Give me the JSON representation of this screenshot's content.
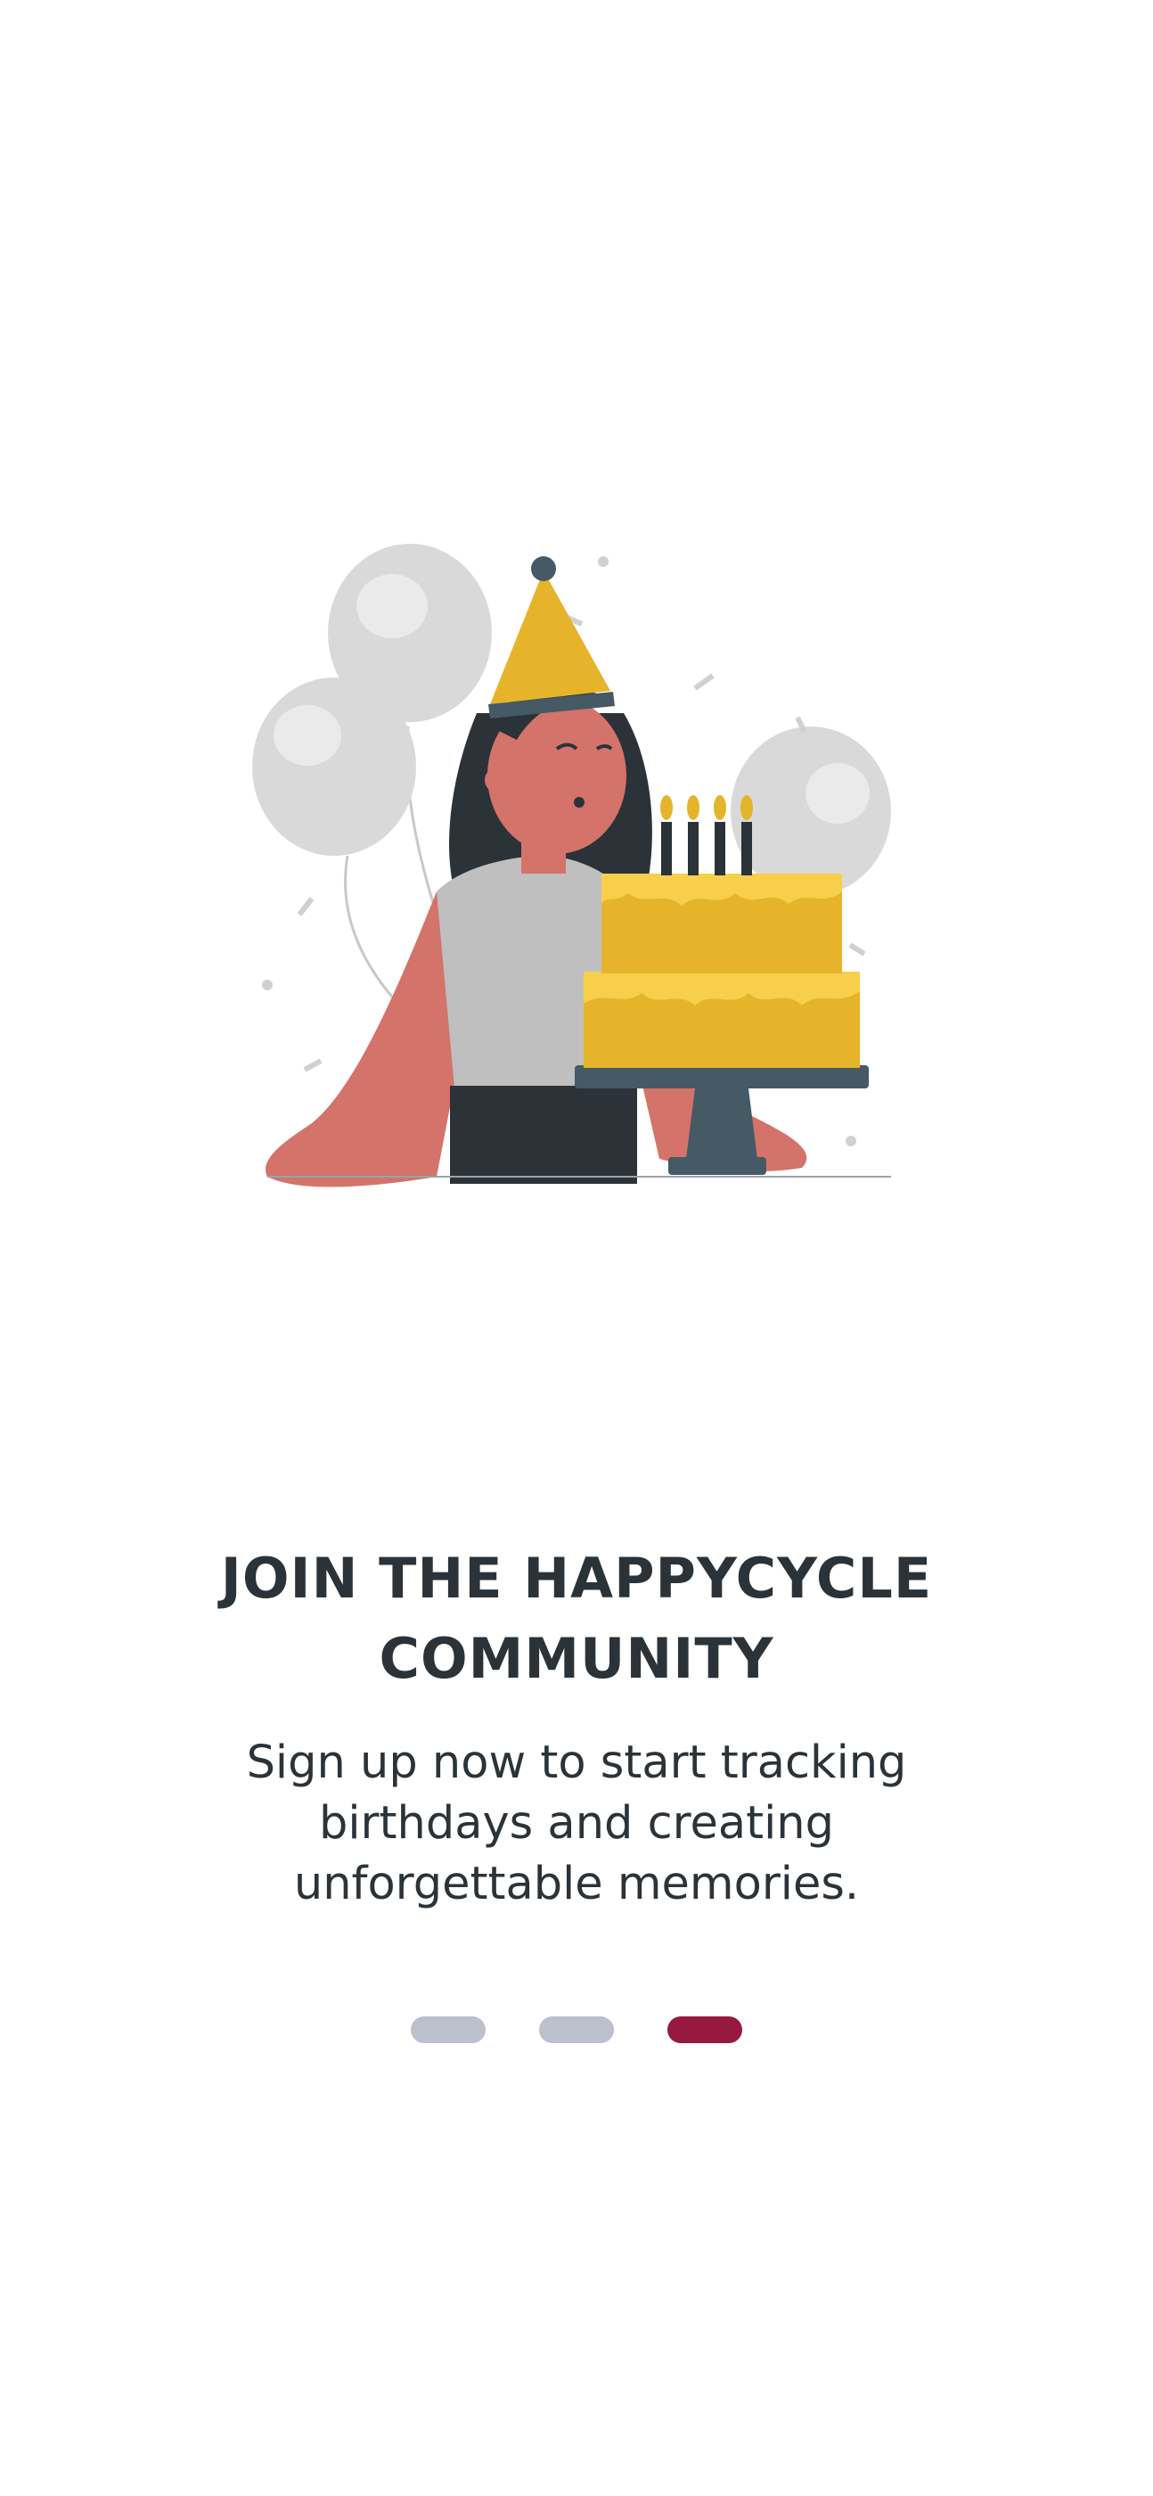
{
  "onboarding": {
    "title_lines": [
      "JOIN THE HAPPYCYCLE",
      "COMMUNITY"
    ],
    "subtitle_lines": [
      "Sign up now to start tracking",
      "birthdays and creating",
      "unforgettable memories."
    ],
    "illustration_icon": "birthday-girl-with-cake-illustration",
    "pagination": {
      "total": 3,
      "active_index": 3
    }
  },
  "colors": {
    "text": "#2b3339",
    "dot_inactive": "#bbc0cc",
    "dot_active": "#98193f",
    "cake": "#e6b42b",
    "skin": "#d4736a",
    "balloon": "#d9d9d9"
  }
}
